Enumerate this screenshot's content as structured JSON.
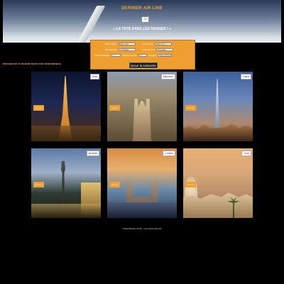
{
  "header": {
    "brand": "DERIMER AIR LINE",
    "home_icon": "home-icon",
    "slogan": "« LA TETE DANS LES NUAGES ! »"
  },
  "search": {
    "rows": [
      {
        "left_label": "Ville de départ",
        "left_value": "Paris / Lyon",
        "right_label": "Ville d'arrivée",
        "right_value": "Paris / Lyon"
      },
      {
        "left_label": "Date de départ",
        "left_value": "jj/mm/aaaa",
        "right_label": "Date de retour",
        "right_value": "jj/mm/aaaa"
      },
      {
        "left_label": "Nombre d'adultes",
        "left_value": "1",
        "mid_label": "Nombre d'enfants",
        "mid_value": "0",
        "right_label": "Catégorie",
        "right_value": "Classe économique"
      }
    ],
    "submit_label": "lancer la recherche"
  },
  "section_title": "Découvrez le monde avec nos destinations",
  "destinations": [
    {
      "city": "Paris",
      "cta": "Go ici !"
    },
    {
      "city": "Barcelone",
      "cta": "Go ici !"
    },
    {
      "city": "Dubaï",
      "cta": "Go ici !"
    },
    {
      "city": "Montréal",
      "cta": "Go ici !"
    },
    {
      "city": "Londres",
      "cta": "Go ici !"
    },
    {
      "city": "Tunis",
      "cta": "Go ici !"
    }
  ],
  "footer": "©2024 Derimer air line - tous droits réservés",
  "colors": {
    "accent": "#f0a030",
    "background": "#000000"
  }
}
